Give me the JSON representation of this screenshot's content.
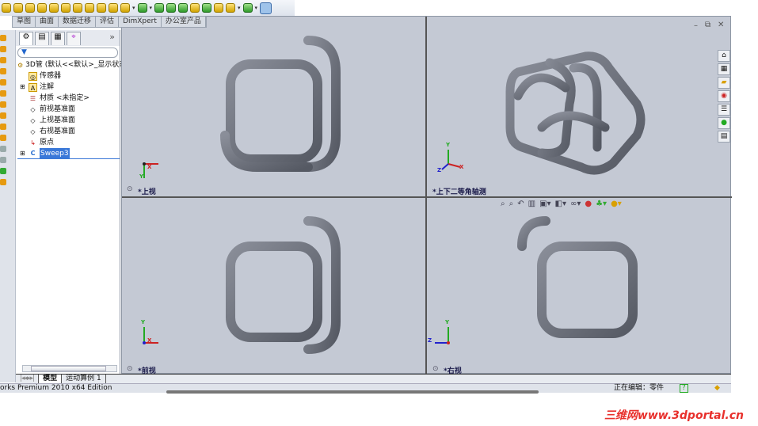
{
  "toolbar": {
    "dropdown_arrow": "▾"
  },
  "tabs": [
    "草图",
    "曲面",
    "数据迁移",
    "评估",
    "DimXpert",
    "办公室产品"
  ],
  "tree": {
    "expand": "»",
    "filter_icon": "▼",
    "items": [
      {
        "label": "3D管 (默认<<默认>_显示状态",
        "icon": "part-icon"
      },
      {
        "label": "传感器",
        "icon": "sensor-icon"
      },
      {
        "label": "注解",
        "icon": "annotation-icon"
      },
      {
        "label": "材质 <未指定>",
        "icon": "material-icon"
      },
      {
        "label": "前视基准面",
        "icon": "plane-icon"
      },
      {
        "label": "上视基准面",
        "icon": "plane-icon"
      },
      {
        "label": "右视基准面",
        "icon": "plane-icon"
      },
      {
        "label": "原点",
        "icon": "origin-icon"
      },
      {
        "label": "Sweep3",
        "icon": "sweep-icon"
      }
    ]
  },
  "viewports": [
    {
      "label": "*上视"
    },
    {
      "label": "*上下二等角轴测"
    },
    {
      "label": "*前视"
    },
    {
      "label": "*右视"
    }
  ],
  "axes": {
    "x": "X",
    "y": "Y",
    "z": "Z"
  },
  "window_buttons": {
    "minimize": "–",
    "restore": "⧉",
    "close": "✕"
  },
  "bottom_tabs": [
    "模型",
    "运动算例 1"
  ],
  "status": {
    "product": "orks Premium 2010 x64 Edition",
    "editing": "正在编辑：零件",
    "help": "?"
  },
  "watermark": "三维网www.3dportal.cn",
  "colors": {
    "tube": "#6b6f7a",
    "viewport": "#c5cad5",
    "accent": "#3a78d8"
  }
}
